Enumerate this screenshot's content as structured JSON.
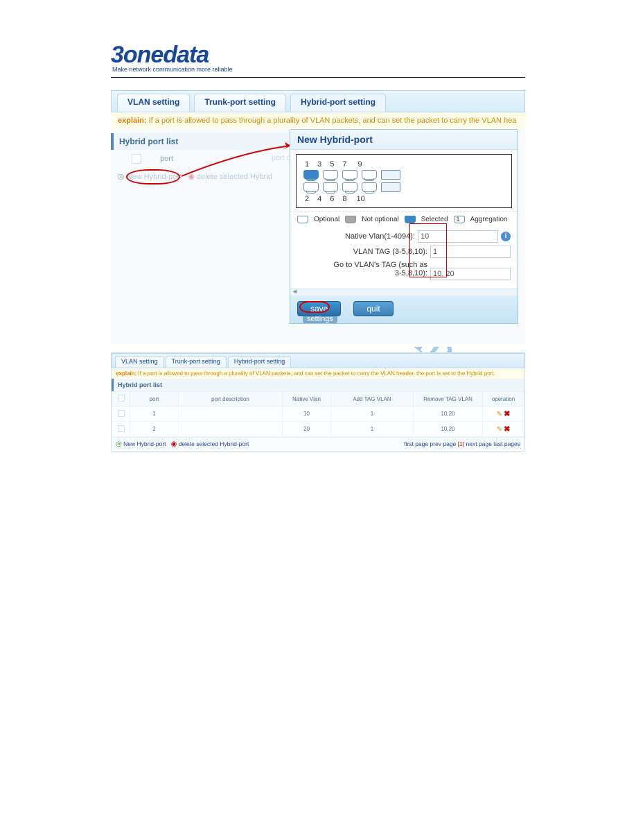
{
  "logo": {
    "brand": "3onedata",
    "tagline": "Make network communication more reliable"
  },
  "watermark": "manualshive.com",
  "shot1": {
    "tabs": {
      "vlan": "VLAN setting",
      "trunk": "Trunk-port setting",
      "hybrid": "Hybrid-port setting"
    },
    "explain": {
      "label": "explain:",
      "text": "If a port is allowed to pass through a plurality of VLAN packets, and can set the packet to carry the VLAN hea"
    },
    "left": {
      "header": "Hybrid port list",
      "col_port": "port",
      "port_de_frag": "port de",
      "new_link": "New Hybrid-port",
      "del_link": "delete selected Hybrid"
    },
    "dlg": {
      "title": "New Hybrid-port",
      "port_top": [
        "1",
        "3",
        "5",
        "7",
        "9"
      ],
      "port_bot": [
        "2",
        "4",
        "6",
        "8",
        "10"
      ],
      "legend": {
        "opt": "Optional",
        "notopt": "Not optional",
        "sel": "Selected",
        "agg": "Aggregation"
      },
      "native_label": "Native Vlan(1-4094):",
      "native_val": "10",
      "tag_label": "VLAN TAG (3-5,8,10):",
      "tag_val": "1",
      "goto_label1": "Go to VLAN's TAG (such as",
      "goto_label2": "3-5,8,10):",
      "goto_val": "10, 20",
      "save": "save",
      "quit": "quit",
      "settings_ghost": "settings"
    }
  },
  "shot2": {
    "tabs": {
      "vlan": "VLAN setting",
      "trunk": "Trunk-port setting",
      "hybrid": "Hybrid-port setting"
    },
    "explain": {
      "label": "explain:",
      "text": "If a port is allowed to pass through a plurality of VLAN packets, and can set the packet to carry the VLAN header, the port is set to the Hybrid port."
    },
    "header": "Hybrid port list",
    "cols": {
      "port": "port",
      "desc": "port description",
      "native": "Native Vlan",
      "add": "Add TAG VLAN",
      "remove": "Remove TAG VLAN",
      "op": "operation"
    },
    "rows": [
      {
        "port": "1",
        "desc": "",
        "native": "10",
        "add": "1",
        "remove": "10,20"
      },
      {
        "port": "2",
        "desc": "",
        "native": "20",
        "add": "1",
        "remove": "10,20"
      }
    ],
    "new_link": "New Hybrid-port",
    "del_link": "delete selected Hybrid-port",
    "pagination": {
      "first": "first page",
      "prev": "prev page",
      "cur": "[1]",
      "next": "next page",
      "last": "last pages"
    }
  }
}
